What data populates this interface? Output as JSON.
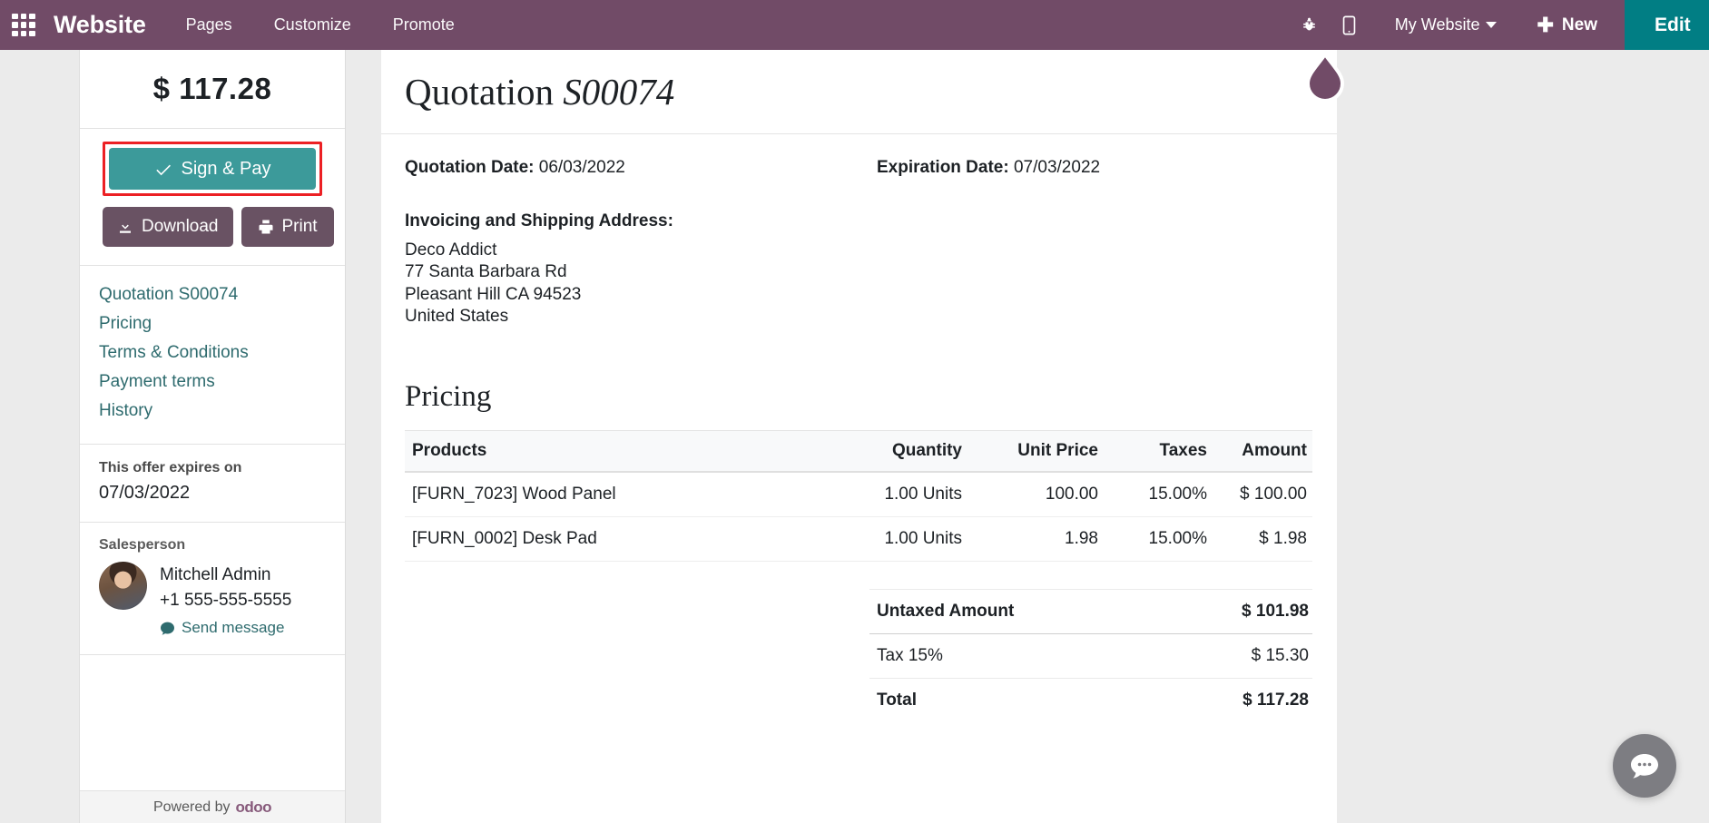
{
  "topbar": {
    "apps_icon": "apps-grid-icon",
    "brand": "Website",
    "nav": [
      {
        "label": "Pages"
      },
      {
        "label": "Customize"
      },
      {
        "label": "Promote"
      }
    ],
    "debug_icon": "bug-icon",
    "mobile_icon": "mobile-preview-icon",
    "site_selector": "My Website",
    "new_label": "New",
    "edit_label": "Edit",
    "background_color": "#714B67",
    "edit_background_color": "#017E84"
  },
  "sidebar": {
    "amount": "$ 117.28",
    "sign_pay_label": "Sign & Pay",
    "sign_pay_color": "#3C9A9A",
    "highlight_color": "#ec2024",
    "download_label": "Download",
    "print_label": "Print",
    "nav_links": [
      {
        "label": "Quotation S00074"
      },
      {
        "label": "Pricing"
      },
      {
        "label": "Terms & Conditions"
      },
      {
        "label": "Payment terms"
      },
      {
        "label": "History"
      }
    ],
    "link_color": "#2E6B6E",
    "expires_label": "This offer expires on",
    "expires_date": "07/03/2022",
    "salesperson_label": "Salesperson",
    "salesperson_name": "Mitchell Admin",
    "salesperson_phone": "+1 555-555-5555",
    "send_message_label": "Send message",
    "powered_by": "Powered by",
    "powered_brand": "odoo"
  },
  "document": {
    "title_prefix": "Quotation",
    "title_ref": "S00074",
    "quotation_date_label": "Quotation Date:",
    "quotation_date": "06/03/2022",
    "expiration_date_label": "Expiration Date:",
    "expiration_date": "07/03/2022",
    "address_heading": "Invoicing and Shipping Address:",
    "address_lines": [
      "Deco Addict",
      "77 Santa Barbara Rd",
      "Pleasant Hill CA 94523",
      "United States"
    ],
    "pricing_heading": "Pricing",
    "table": {
      "headers": [
        "Products",
        "Quantity",
        "Unit Price",
        "Taxes",
        "Amount"
      ],
      "rows": [
        {
          "product": "[FURN_7023] Wood Panel",
          "quantity": "1.00 Units",
          "unit_price": "100.00",
          "taxes": "15.00%",
          "amount": "$ 100.00"
        },
        {
          "product": "[FURN_0002] Desk Pad",
          "quantity": "1.00 Units",
          "unit_price": "1.98",
          "taxes": "15.00%",
          "amount": "$ 1.98"
        }
      ]
    },
    "totals": [
      {
        "label": "Untaxed Amount",
        "value": "$ 101.98",
        "strong": true
      },
      {
        "label": "Tax 15%",
        "value": "$ 15.30",
        "strong": false
      },
      {
        "label": "Total",
        "value": "$ 117.28",
        "strong": true
      }
    ]
  },
  "widgets": {
    "pin_icon": "map-pin-teardrop-icon",
    "chat_icon": "chat-bubble-icon"
  }
}
